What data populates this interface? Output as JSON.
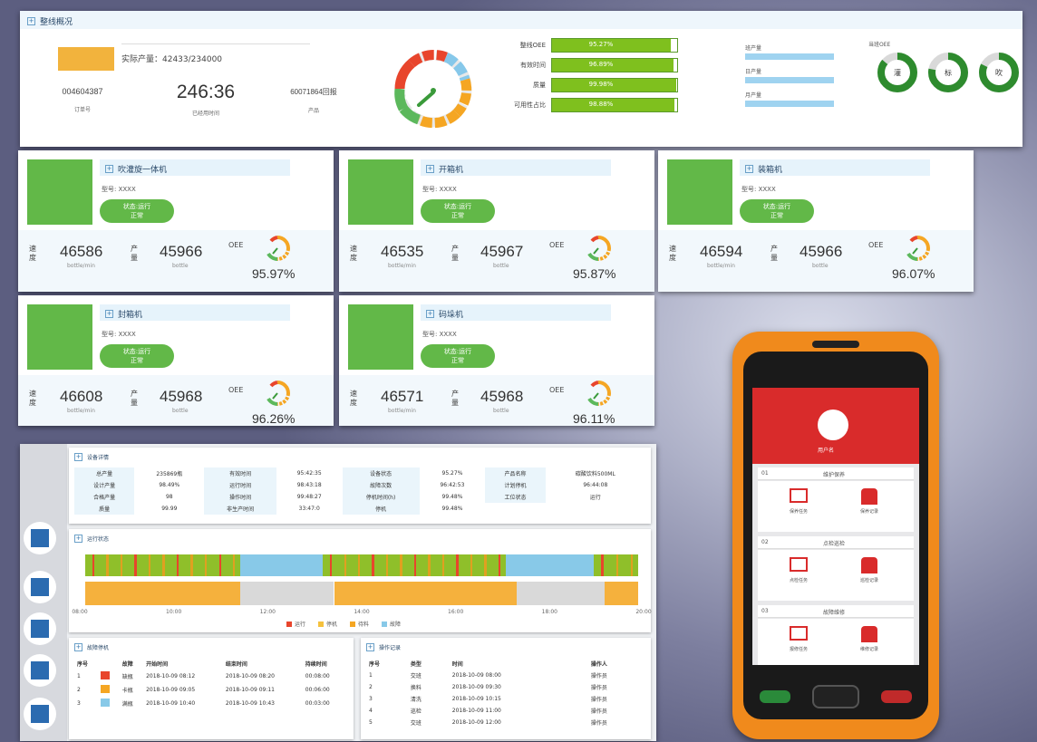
{
  "overview": {
    "header": "整线概况",
    "actual_output_label": "实际产量：42433/234000",
    "stats": [
      {
        "value": "004604387",
        "label": "订单号"
      },
      {
        "value": "246:36",
        "label": "已经用时间"
      },
      {
        "value": "60071864回报",
        "label": "产品"
      }
    ],
    "bars": [
      {
        "label": "整线OEE",
        "value": "95.27%",
        "fraction": 0.95
      },
      {
        "label": "有效时间",
        "value": "96.89%",
        "fraction": 0.97
      },
      {
        "label": "质量",
        "value": "99.98%",
        "fraction": 0.99
      },
      {
        "label": "可用性占比",
        "value": "98.88%",
        "fraction": 0.98
      }
    ],
    "side_items": [
      "班产量",
      "日产量",
      "月产量"
    ],
    "rings_title": "当班OEE",
    "rings": [
      {
        "center": "灌",
        "fraction": 0.86
      },
      {
        "center": "标",
        "fraction": 0.78
      },
      {
        "center": "吹",
        "fraction": 0.82
      }
    ]
  },
  "machines": [
    {
      "name": "吹灌旋一体机",
      "model": "型号: XXXX",
      "status": "状态:运行\n正常",
      "speed": "46586",
      "speed_label": "速度",
      "speed_unit": "bottle/min",
      "output": "45966",
      "output_label": "产量",
      "output_unit": "bottle",
      "oee_label": "OEE",
      "oee": "95.97%",
      "color": "#62b848"
    },
    {
      "name": "开箱机",
      "model": "型号: XXXX",
      "status": "状态:运行\n正常",
      "speed": "46535",
      "speed_label": "速度",
      "speed_unit": "bottle/min",
      "output": "45967",
      "output_label": "产量",
      "output_unit": "bottle",
      "oee_label": "OEE",
      "oee": "95.87%",
      "color": "#62b848"
    },
    {
      "name": "装箱机",
      "model": "型号: XXXX",
      "status": "状态:运行\n正常",
      "speed": "46594",
      "speed_label": "速度",
      "speed_unit": "bottle/min",
      "output": "45966",
      "output_label": "产量",
      "output_unit": "bottle",
      "oee_label": "OEE",
      "oee": "96.07%",
      "color": "#62b848"
    },
    {
      "name": "封箱机",
      "model": "型号: XXXX",
      "status": "状态:运行\n正常",
      "speed": "46608",
      "speed_label": "速度",
      "speed_unit": "bottle/min",
      "output": "45968",
      "output_label": "产量",
      "output_unit": "bottle",
      "oee_label": "OEE",
      "oee": "96.26%",
      "color": "#62b848"
    },
    {
      "name": "码垛机",
      "model": "型号: XXXX",
      "status": "状态:运行\n正常",
      "speed": "46571",
      "speed_label": "速度",
      "speed_unit": "bottle/min",
      "output": "45968",
      "output_label": "产量",
      "output_unit": "bottle",
      "oee_label": "OEE",
      "oee": "96.11%",
      "color": "#62b848"
    }
  ],
  "detail": {
    "summary_header": "设备详情",
    "summary_rows": [
      [
        "总产量",
        "235869瓶",
        "有效时间",
        "95:42:35",
        "设备状态",
        "95.27%",
        "产品名称",
        "碳酸饮料500ML"
      ],
      [
        "设计产量",
        "98.49%",
        "运行时间",
        "98:43:18",
        "故障次数",
        "96:42:53",
        "计划停机",
        "96:44:08"
      ],
      [
        "合格产量",
        "98",
        "操作时间",
        "99:48:27",
        "停机时间(h)",
        "99.48%",
        "工位状态",
        "运行"
      ],
      [
        "质量",
        "99.99",
        "非生产时间",
        "33:47:0",
        "停机",
        "99.48%",
        "",
        ""
      ]
    ],
    "timeline_header": "运行状态",
    "timeline_ticks": [
      "08:00",
      "10:00",
      "12:00",
      "14:00",
      "16:00",
      "18:00",
      "20:00"
    ],
    "timeline_legend": [
      "运行",
      "停机",
      "待料",
      "故障"
    ],
    "alarm_header": "故障停机",
    "alarm_columns": [
      "序号",
      "",
      "故障",
      "开始时间",
      "结束时间",
      "持续时间"
    ],
    "alarm_rows": [
      [
        "1",
        "",
        "缺瓶",
        "2018-10-09 08:12",
        "2018-10-09 08:20",
        "00:08:00"
      ],
      [
        "2",
        "",
        "卡瓶",
        "2018-10-09 09:05",
        "2018-10-09 09:11",
        "00:06:00"
      ],
      [
        "3",
        "",
        "满瓶",
        "2018-10-09 10:40",
        "2018-10-09 10:43",
        "00:03:00"
      ]
    ],
    "log_header": "操作记录",
    "log_columns": [
      "序号",
      "类型",
      "时间",
      "操作人"
    ],
    "log_rows": [
      [
        "1",
        "交班",
        "2018-10-09 08:00",
        "操作员"
      ],
      [
        "2",
        "换料",
        "2018-10-09 09:30",
        "操作员"
      ],
      [
        "3",
        "清洗",
        "2018-10-09 10:15",
        "操作员"
      ],
      [
        "4",
        "巡检",
        "2018-10-09 11:00",
        "操作员"
      ],
      [
        "5",
        "交班",
        "2018-10-09 12:00",
        "操作员"
      ]
    ]
  },
  "phone": {
    "user": "用户名",
    "sections": [
      {
        "label": "01",
        "title": "维护保养",
        "items": [
          "保养任务",
          "保养记录"
        ]
      },
      {
        "label": "02",
        "title": "点检巡检",
        "items": [
          "点检任务",
          "巡检记录"
        ]
      },
      {
        "label": "03",
        "title": "故障维修",
        "items": [
          "报修任务",
          "维修记录"
        ]
      }
    ]
  }
}
